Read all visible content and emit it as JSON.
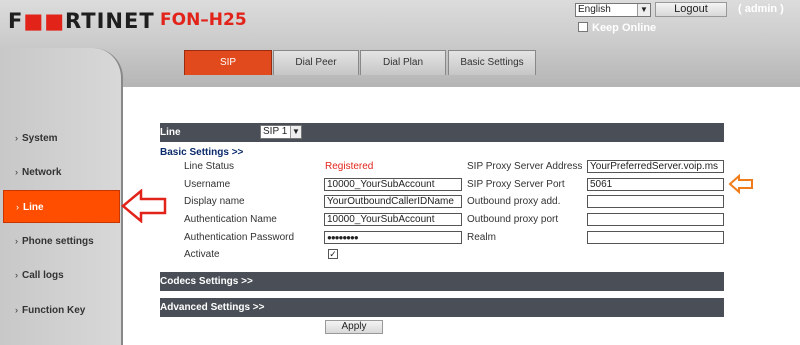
{
  "header": {
    "brand": "F",
    "brand_rest": "RTINET",
    "brand_mark": "::",
    "model": "FON–H25",
    "language": "English",
    "logout_label": "Logout",
    "user": "( admin )",
    "keep_online_label": "Keep Online"
  },
  "tabs": [
    {
      "label": "SIP",
      "active": true
    },
    {
      "label": "Dial Peer",
      "active": false
    },
    {
      "label": "Dial Plan",
      "active": false
    },
    {
      "label": "Basic Settings",
      "active": false
    }
  ],
  "sidebar": {
    "items": [
      {
        "label": "System"
      },
      {
        "label": "Network"
      },
      {
        "label": "Line",
        "active": true
      },
      {
        "label": "Phone settings"
      },
      {
        "label": "Call logs"
      },
      {
        "label": "Function Key"
      }
    ]
  },
  "line": {
    "label": "Line",
    "selected": "SIP 1"
  },
  "basic": {
    "title": "Basic Settings >>",
    "line_status_label": "Line Status",
    "line_status_value": "Registered",
    "username_label": "Username",
    "username_value": "10000_YourSubAccount",
    "display_name_label": "Display name",
    "display_name_value": "YourOutboundCallerIDName",
    "auth_name_label": "Authentication Name",
    "auth_name_value": "10000_YourSubAccount",
    "auth_password_label": "Authentication Password",
    "auth_password_value": "●●●●●●●●",
    "activate_label": "Activate",
    "activate_checked": true,
    "proxy_address_label": "SIP Proxy Server Address",
    "proxy_address_value": "YourPreferredServer.voip.ms",
    "proxy_port_label": "SIP Proxy Server Port",
    "proxy_port_value": "5061",
    "outbound_add_label": "Outbound proxy add.",
    "outbound_add_value": "",
    "outbound_port_label": "Outbound proxy port",
    "outbound_port_value": "",
    "realm_label": "Realm",
    "realm_value": ""
  },
  "codecs": {
    "title": "Codecs Settings >>"
  },
  "advanced": {
    "title": "Advanced Settings >>"
  },
  "apply_label": "Apply",
  "colors": {
    "accent": "#e14a1c",
    "brand_red": "#e2231a",
    "section_bar": "#4a4f57",
    "sidebar_active": "#ff4e00",
    "annotation_arrow_red": "#e2231a",
    "annotation_arrow_orange": "#f07c1a"
  }
}
